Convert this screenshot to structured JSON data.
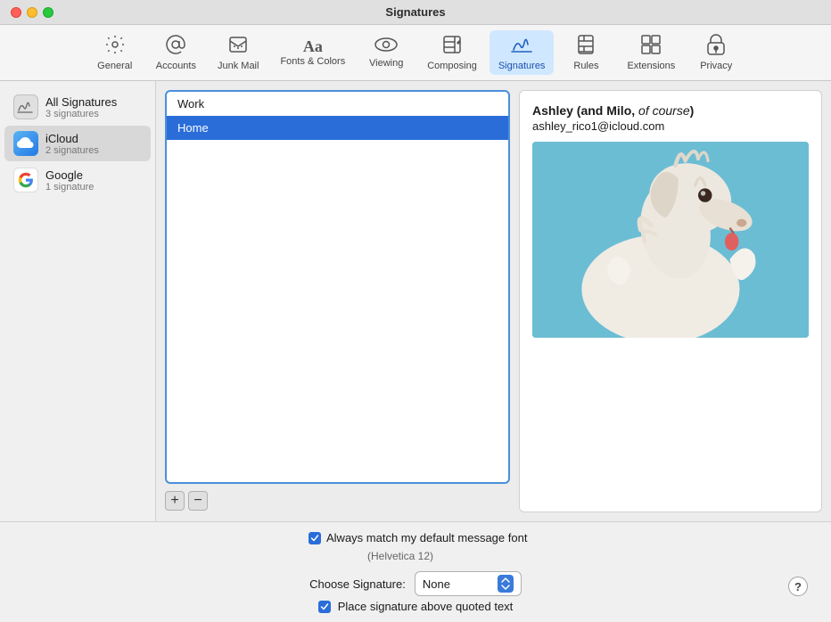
{
  "titlebar": {
    "title": "Signatures"
  },
  "toolbar": {
    "items": [
      {
        "id": "general",
        "label": "General",
        "icon": "⚙️"
      },
      {
        "id": "accounts",
        "label": "Accounts",
        "icon": "✉"
      },
      {
        "id": "junk-mail",
        "label": "Junk Mail",
        "icon": "🗑"
      },
      {
        "id": "fonts-colors",
        "label": "Fonts & Colors",
        "icon": "Aa"
      },
      {
        "id": "viewing",
        "label": "Viewing",
        "icon": "👓"
      },
      {
        "id": "composing",
        "label": "Composing",
        "icon": "✏"
      },
      {
        "id": "signatures",
        "label": "Signatures",
        "icon": "✍"
      },
      {
        "id": "rules",
        "label": "Rules",
        "icon": "📥"
      },
      {
        "id": "extensions",
        "label": "Extensions",
        "icon": "🧩"
      },
      {
        "id": "privacy",
        "label": "Privacy",
        "icon": "✋"
      }
    ]
  },
  "sidebar": {
    "items": [
      {
        "id": "all-signatures",
        "name": "All Signatures",
        "count": "3 signatures",
        "icon_type": "all"
      },
      {
        "id": "icloud",
        "name": "iCloud",
        "count": "2 signatures",
        "icon_type": "icloud"
      },
      {
        "id": "google",
        "name": "Google",
        "count": "1 signature",
        "icon_type": "google"
      }
    ]
  },
  "signatures_list": {
    "items": [
      {
        "id": "work",
        "label": "Work"
      },
      {
        "id": "home",
        "label": "Home"
      }
    ]
  },
  "list_controls": {
    "add_label": "+",
    "remove_label": "−"
  },
  "preview": {
    "name_bold": "Ashley",
    "name_rest": " (and Milo, ",
    "name_italic": "of course",
    "name_end": ")",
    "email": "ashley_rico1@icloud.com"
  },
  "footer": {
    "font_match_label": "Always match my default message font",
    "font_hint": "(Helvetica 12)",
    "choose_sig_label": "Choose Signature:",
    "dropdown_value": "None",
    "place_sig_label": "Place signature above quoted text",
    "help_label": "?"
  }
}
